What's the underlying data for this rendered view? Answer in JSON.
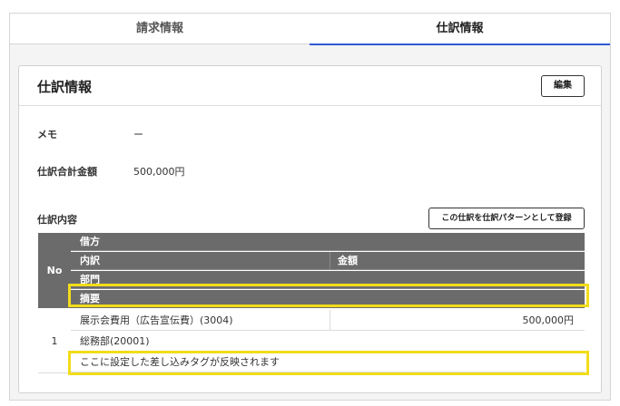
{
  "tabs": [
    {
      "label": "請求情報",
      "active": false
    },
    {
      "label": "仕訳情報",
      "active": true
    }
  ],
  "card": {
    "title": "仕訳情報",
    "edit_label": "編集"
  },
  "fields": {
    "memo_label": "メモ",
    "memo_value": "ー",
    "total_label": "仕訳合計金額",
    "total_value": "500,000円",
    "content_label": "仕訳内容"
  },
  "pattern_button": "この仕訳を仕訳パターンとして登録",
  "table": {
    "header": {
      "no": "No",
      "debit": "借方",
      "breakdown": "内訳",
      "amount": "金額",
      "department": "部門",
      "summary": "摘要"
    },
    "rows": [
      {
        "no": "1",
        "breakdown": "展示会費用（広告宣伝費）(3004)",
        "amount": "500,000円",
        "department": "総務部(20001)",
        "summary": "ここに設定した差し込みタグが反映されます"
      }
    ]
  },
  "colors": {
    "accent": "#2f5bd4",
    "header_bg": "#6b6b6b",
    "highlight": "#f2dc19"
  }
}
